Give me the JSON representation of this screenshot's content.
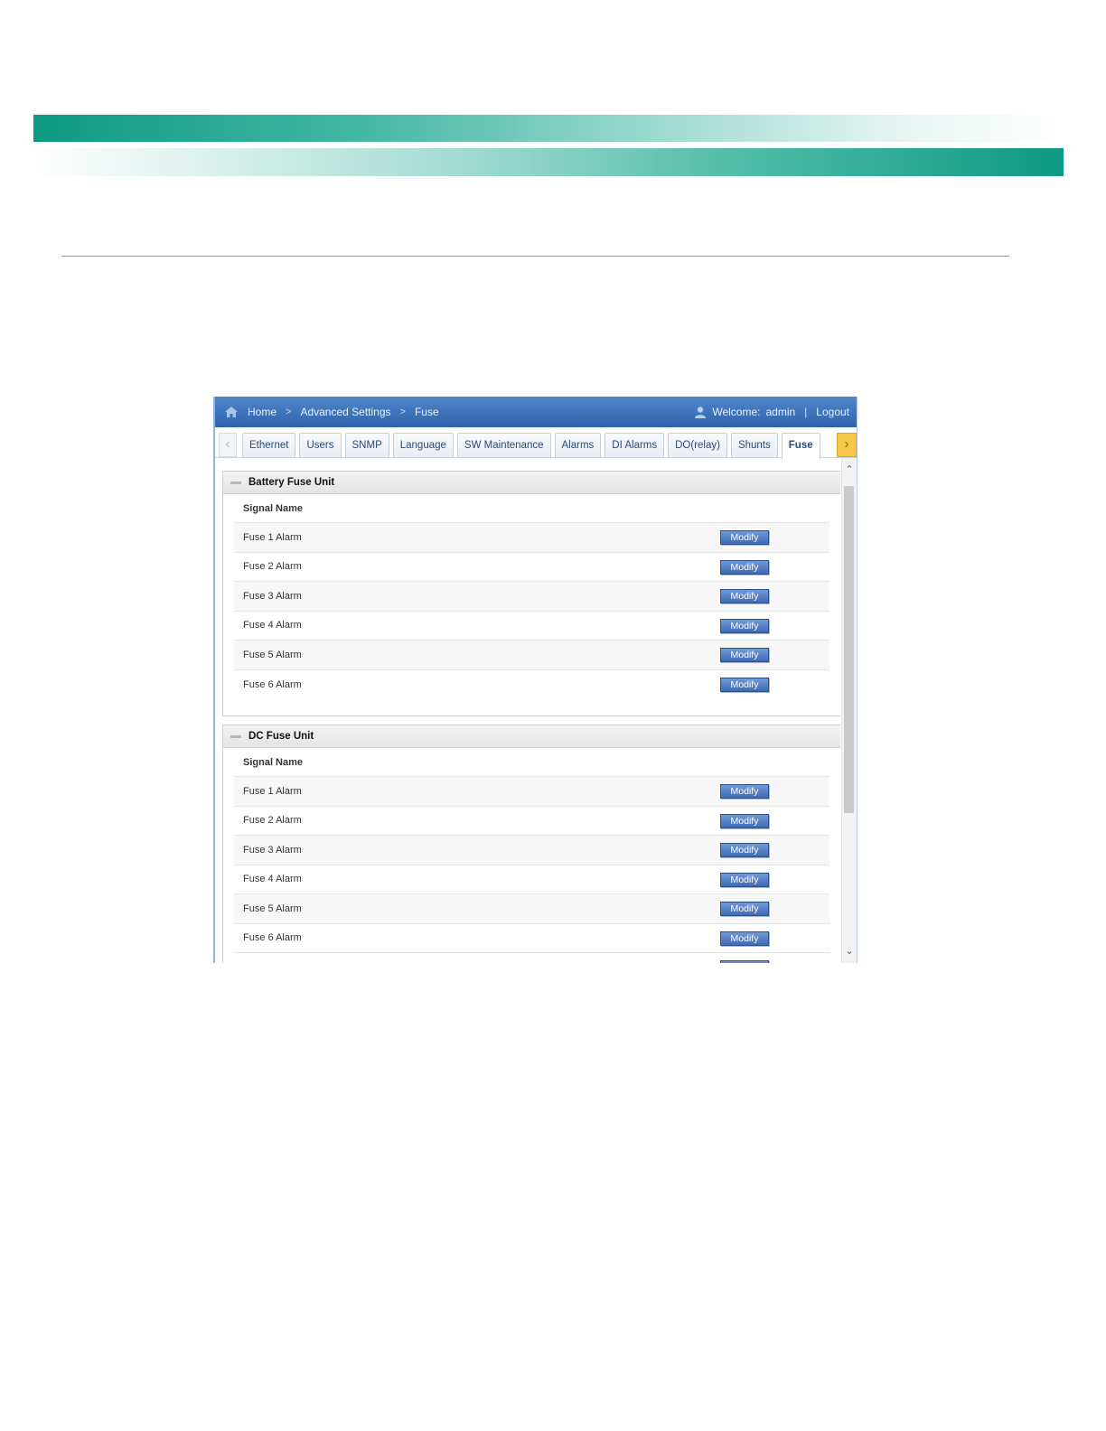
{
  "breadcrumb": {
    "home": "Home",
    "advanced": "Advanced Settings",
    "current": "Fuse"
  },
  "user": {
    "welcome": "Welcome:",
    "name": "admin",
    "separator": "|",
    "logout": "Logout"
  },
  "tabs": [
    "Ethernet",
    "Users",
    "SNMP",
    "Language",
    "SW Maintenance",
    "Alarms",
    "DI Alarms",
    "DO(relay)",
    "Shunts",
    "Fuse"
  ],
  "active_tab": "Fuse",
  "panels": [
    {
      "title": "Battery Fuse Unit",
      "column_header": "Signal Name",
      "rows": [
        "Fuse 1 Alarm",
        "Fuse 2 Alarm",
        "Fuse 3 Alarm",
        "Fuse 4 Alarm",
        "Fuse 5 Alarm",
        "Fuse 6 Alarm"
      ],
      "button_label": "Modify"
    },
    {
      "title": "DC Fuse Unit",
      "column_header": "Signal Name",
      "rows": [
        "Fuse 1 Alarm",
        "Fuse 2 Alarm",
        "Fuse 3 Alarm",
        "Fuse 4 Alarm",
        "Fuse 5 Alarm",
        "Fuse 6 Alarm"
      ],
      "button_label": "Modify"
    }
  ],
  "colors": {
    "header_blue": "#2f63ad",
    "button_blue": "#3f6bb5",
    "accent_teal": "#0e9a82",
    "tab_scroll_yellow": "#f5c74a"
  },
  "icons": {
    "home": "home-icon",
    "user": "user-icon",
    "tab_left": "chevron-left-icon",
    "tab_right": "chevron-right-icon",
    "collapse": "collapse-icon",
    "scroll_up": "chevron-up-icon",
    "scroll_down": "chevron-down-icon"
  }
}
